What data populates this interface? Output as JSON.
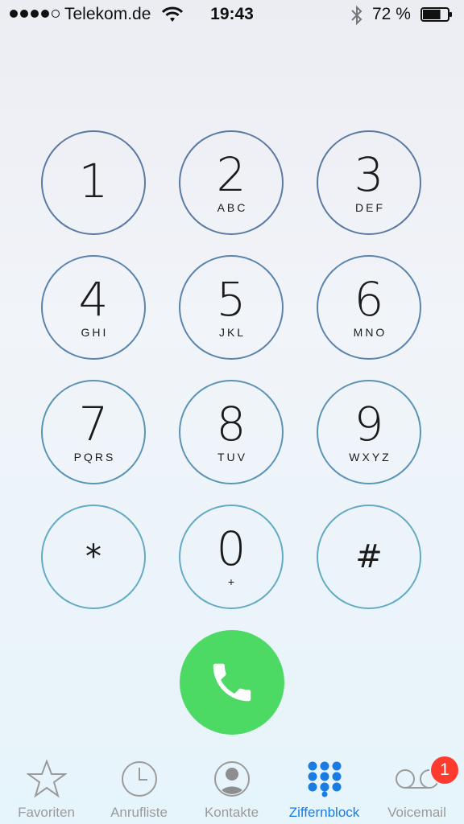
{
  "status_bar": {
    "carrier": "Telekom.de",
    "time": "19:43",
    "battery_percent": "72 %",
    "battery_level": 0.72,
    "signal_bars": 4
  },
  "keypad": {
    "keys": [
      {
        "digit": "1",
        "letters": ""
      },
      {
        "digit": "2",
        "letters": "ABC"
      },
      {
        "digit": "3",
        "letters": "DEF"
      },
      {
        "digit": "4",
        "letters": "GHI"
      },
      {
        "digit": "5",
        "letters": "JKL"
      },
      {
        "digit": "6",
        "letters": "MNO"
      },
      {
        "digit": "7",
        "letters": "PQRS"
      },
      {
        "digit": "8",
        "letters": "TUV"
      },
      {
        "digit": "9",
        "letters": "WXYZ"
      },
      {
        "digit": "*",
        "letters": ""
      },
      {
        "digit": "0",
        "letters": "+"
      },
      {
        "digit": "#",
        "letters": ""
      }
    ]
  },
  "call_button": {
    "icon": "phone-icon",
    "color": "#4cd964"
  },
  "tab_bar": {
    "tabs": [
      {
        "label": "Favoriten",
        "icon": "star-icon"
      },
      {
        "label": "Anrufliste",
        "icon": "clock-icon"
      },
      {
        "label": "Kontakte",
        "icon": "contact-icon"
      },
      {
        "label": "Ziffernblock",
        "icon": "keypad-icon",
        "active": true
      },
      {
        "label": "Voicemail",
        "icon": "voicemail-icon"
      }
    ],
    "voicemail_badge": "1"
  },
  "colors": {
    "accent": "#1a7ce2",
    "inactive": "#9b9b9b",
    "badge": "#ff3b30"
  }
}
